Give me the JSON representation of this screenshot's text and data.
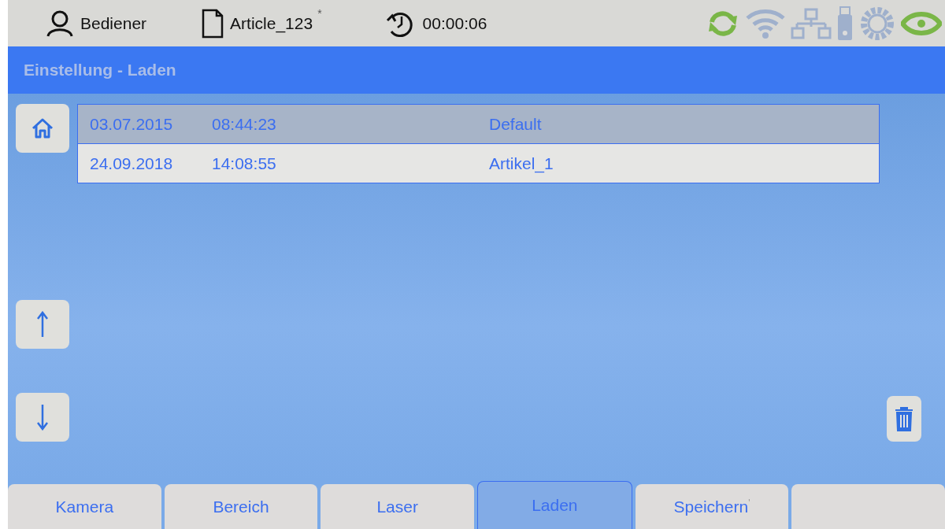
{
  "status_bar": {
    "user": "Bediener",
    "file": "Article_123",
    "modified": "*",
    "timer": "00:00:06",
    "indicators": [
      {
        "kind": "sync",
        "active": true
      },
      {
        "kind": "wifi",
        "active": false
      },
      {
        "kind": "network",
        "active": false
      },
      {
        "kind": "usb",
        "active": false
      },
      {
        "kind": "gear",
        "active": false
      },
      {
        "kind": "eye",
        "active": true
      }
    ]
  },
  "title": "Einstellung - Laden",
  "table": {
    "rows": [
      {
        "date": "03.07.2015",
        "time": "08:44:23",
        "name": "Default",
        "selected": true
      },
      {
        "date": "24.09.2018",
        "time": "14:08:55",
        "name": "Artikel_1",
        "selected": false
      }
    ]
  },
  "tabs": [
    {
      "label": "Kamera",
      "selected": false
    },
    {
      "label": "Bereich",
      "selected": false
    },
    {
      "label": "Laser",
      "selected": false
    },
    {
      "label": "Laden",
      "selected": true
    },
    {
      "label": "Speichern",
      "mark": "'",
      "selected": false
    },
    {
      "selected": false
    }
  ]
}
